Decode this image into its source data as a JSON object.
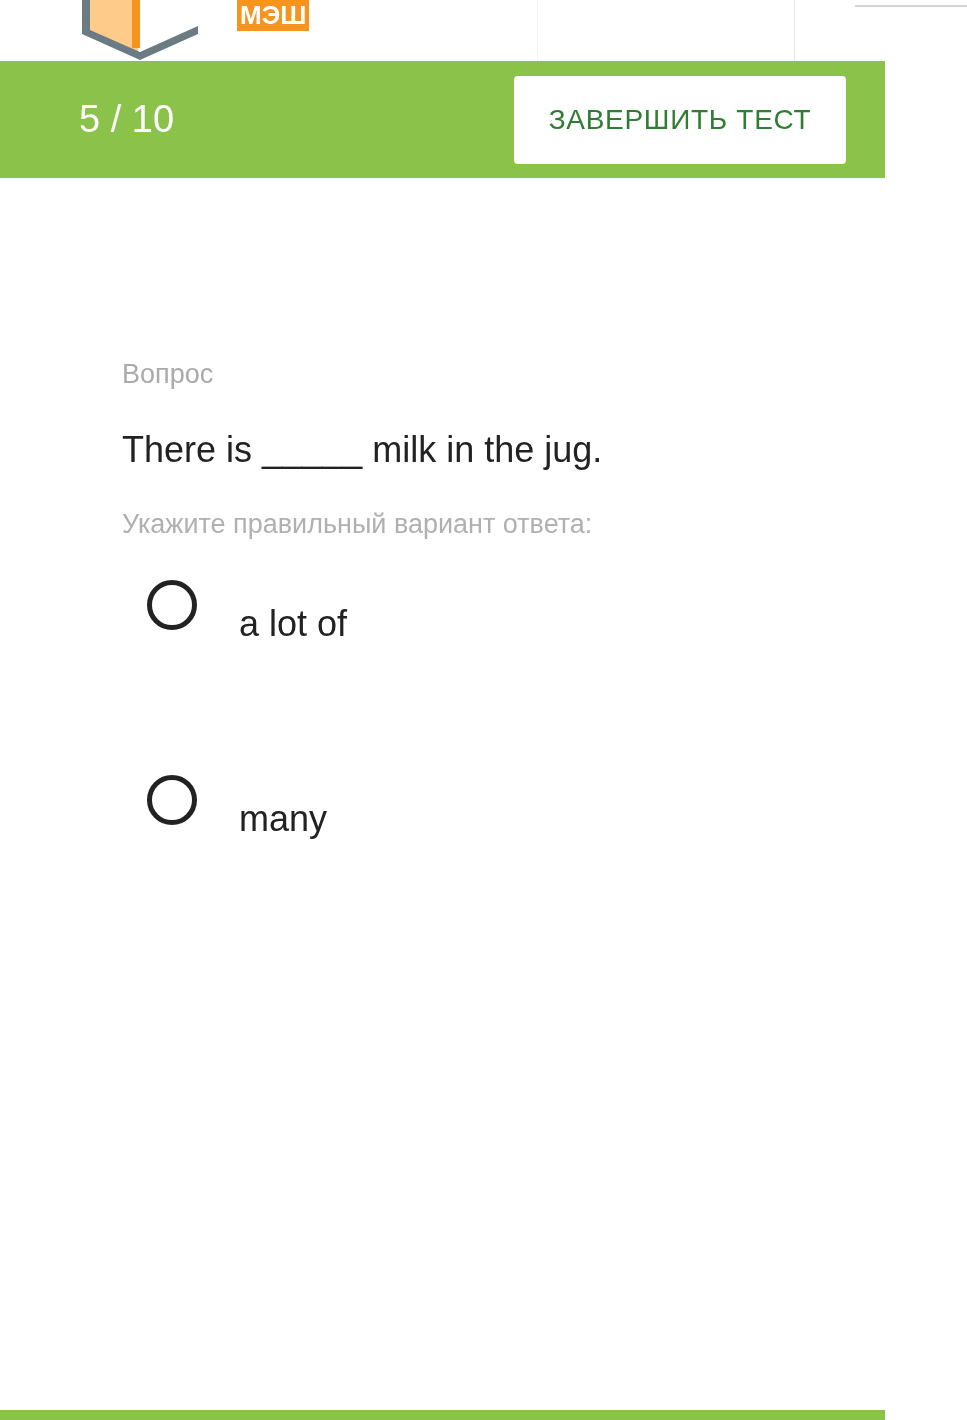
{
  "logo": {
    "text": "МЭШ"
  },
  "progress": {
    "text": "5 / 10"
  },
  "finish_button": {
    "label": "ЗАВЕРШИТЬ ТЕСТ"
  },
  "question": {
    "caption": "Вопрос",
    "text": "There is _____ milk in the jug.",
    "instruction": "Укажите правильный вариант ответа:"
  },
  "options": [
    {
      "label": "a lot of",
      "selected": false
    },
    {
      "label": "many",
      "selected": false
    }
  ]
}
